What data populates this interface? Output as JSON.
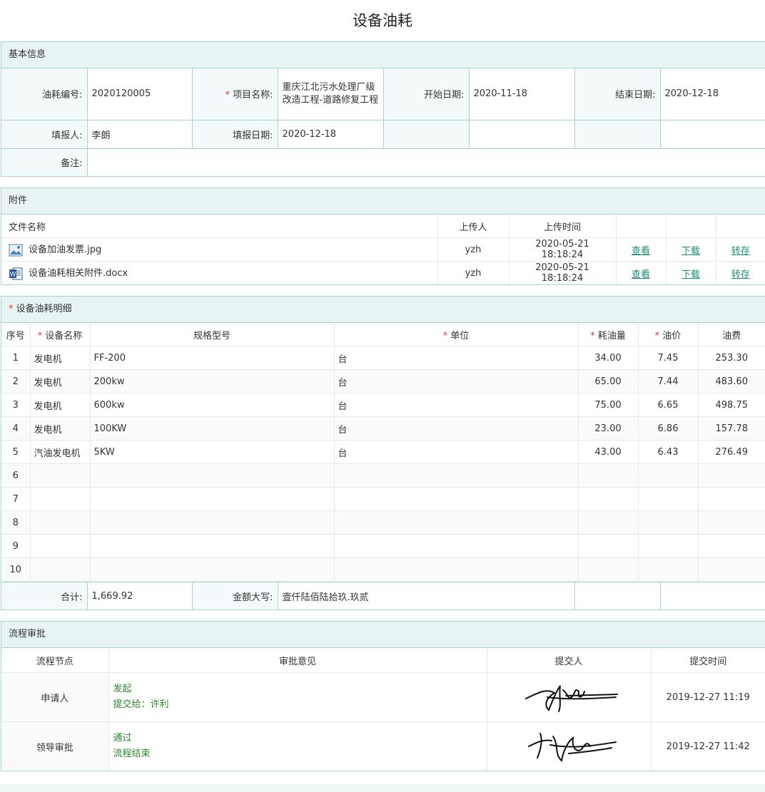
{
  "title": "设备油耗",
  "basic": {
    "header": "基本信息",
    "code_label": "油耗编号:",
    "code": "2020120005",
    "project_label": "项目名称:",
    "project": "重庆江北污水处理厂级改造工程-道路修复工程",
    "start_label": "开始日期:",
    "start": "2020-11-18",
    "end_label": "结束日期:",
    "end": "2020-12-18",
    "reporter_label": "填报人:",
    "reporter": "李朗",
    "report_date_label": "填报日期:",
    "report_date": "2020-12-18",
    "remark_label": "备注:",
    "remark": ""
  },
  "attachments": {
    "header": "附件",
    "columns": [
      "文件名称",
      "上传人",
      "上传时间"
    ],
    "files": [
      {
        "name": "设备加油发票.jpg",
        "icon": "image-file-icon",
        "uploader": "yzh",
        "time": "2020-05-21 18:18:24",
        "view": "查看",
        "download": "下载",
        "transfer": "转存"
      },
      {
        "name": "设备油耗相关附件.docx",
        "icon": "word-file-icon",
        "uploader": "yzh",
        "time": "2020-05-21 18:18:24",
        "view": "查看",
        "download": "下载",
        "transfer": "转存"
      }
    ]
  },
  "detail": {
    "header": "设备油耗明细",
    "columns": [
      "序号",
      "设备名称",
      "规格型号",
      "单位",
      "耗油量",
      "油价",
      "油费"
    ],
    "rows": [
      {
        "no": "1",
        "name": "发电机",
        "spec": "FF-200",
        "unit": "台",
        "qty": "34.00",
        "price": "7.45",
        "fee": "253.30"
      },
      {
        "no": "2",
        "name": "发电机",
        "spec": "200kw",
        "unit": "台",
        "qty": "65.00",
        "price": "7.44",
        "fee": "483.60"
      },
      {
        "no": "3",
        "name": "发电机",
        "spec": "600kw",
        "unit": "台",
        "qty": "75.00",
        "price": "6.65",
        "fee": "498.75"
      },
      {
        "no": "4",
        "name": "发电机",
        "spec": "100KW",
        "unit": "台",
        "qty": "23.00",
        "price": "6.86",
        "fee": "157.78"
      },
      {
        "no": "5",
        "name": "汽油发电机",
        "spec": "5KW",
        "unit": "台",
        "qty": "43.00",
        "price": "6.43",
        "fee": "276.49"
      },
      {
        "no": "6",
        "name": "",
        "spec": "",
        "unit": "",
        "qty": "",
        "price": "",
        "fee": ""
      },
      {
        "no": "7",
        "name": "",
        "spec": "",
        "unit": "",
        "qty": "",
        "price": "",
        "fee": ""
      },
      {
        "no": "8",
        "name": "",
        "spec": "",
        "unit": "",
        "qty": "",
        "price": "",
        "fee": ""
      },
      {
        "no": "9",
        "name": "",
        "spec": "",
        "unit": "",
        "qty": "",
        "price": "",
        "fee": ""
      },
      {
        "no": "10",
        "name": "",
        "spec": "",
        "unit": "",
        "qty": "",
        "price": "",
        "fee": ""
      }
    ],
    "total_label": "合计:",
    "total": "1,669.92",
    "capital_label": "金额大写:",
    "capital": "壹仟陆佰陆拾玖.玖贰"
  },
  "flow": {
    "header": "流程审批",
    "columns": [
      "流程节点",
      "审批意见",
      "提交人",
      "提交时间"
    ],
    "rows": [
      {
        "node": "申请人",
        "opinion1": "发起",
        "opinion2": "提交给：许利",
        "time": "2019-12-27 11:19"
      },
      {
        "node": "领导审批",
        "opinion1": "通过",
        "opinion2": "流程结束",
        "time": "2019-12-27 11:42"
      }
    ]
  },
  "colors": {
    "border": "#a9d3cf",
    "header_bg": "#e7f4f3",
    "link": "#1f8f74",
    "required": "#e4393c",
    "opinion": "#2a8a2a"
  }
}
